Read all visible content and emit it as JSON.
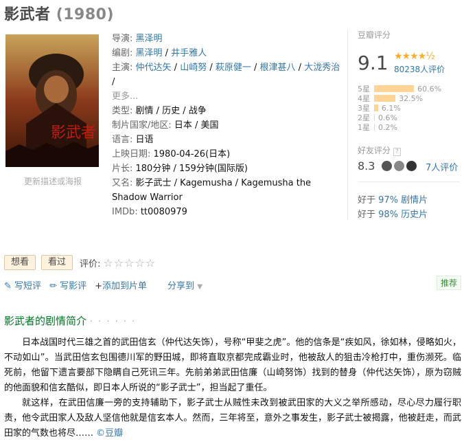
{
  "title": {
    "name": "影武者",
    "year": "(1980)"
  },
  "poster": {
    "update_text": "更新描述或海报",
    "art_text": "影武者"
  },
  "info": {
    "director_label": "导演: ",
    "director": "黑泽明",
    "writer_label": "编剧: ",
    "writers": [
      "黑泽明",
      "井手雅人"
    ],
    "cast_label": "主演: ",
    "cast": [
      "仲代达矢",
      "山崎努",
      "萩原健一",
      "根津甚八",
      "大泷秀治"
    ],
    "more": "更多...",
    "genre_label": "类型: ",
    "genres": "剧情 / 历史 / 战争",
    "country_label": "制片国家/地区: ",
    "country": "日本 / 美国",
    "language_label": "语言: ",
    "language": "日语",
    "release_label": "上映日期: ",
    "release": "1980-04-26(日本)",
    "runtime_label": "片长: ",
    "runtime": "180分钟 / 159分钟(国际版)",
    "aka_label": "又名: ",
    "aka": "影子武士 / Kagemusha / Kagemusha the Shadow Warrior",
    "imdb_label": "IMDb: ",
    "imdb": "tt0080979"
  },
  "rating": {
    "label": "豆瓣评分",
    "score": "9.1",
    "stars": "★★★★½",
    "count": "80238人评价",
    "breakdown": [
      {
        "label": "5星",
        "pct": "60.6%",
        "value": 60.6
      },
      {
        "label": "4星",
        "pct": "32.5%",
        "value": 32.5
      },
      {
        "label": "3星",
        "pct": "6.1%",
        "value": 6.1
      },
      {
        "label": "2星",
        "pct": "0.6%",
        "value": 0.6
      },
      {
        "label": "1星",
        "pct": "0.2%",
        "value": 0.2
      }
    ],
    "friend_label": "好友评分",
    "friend_help": "?",
    "friend_score": "8.3",
    "friend_count": "7人评价",
    "better": [
      {
        "prefix": "好于 ",
        "pct": "97%",
        "genre": " 剧情片"
      },
      {
        "prefix": "好于 ",
        "pct": "98%",
        "genre": " 历史片"
      }
    ]
  },
  "actions": {
    "want": "想看",
    "watched": "看过",
    "rate_label": "评价:",
    "empty_stars": "☆☆☆☆☆",
    "short_review": "写短评",
    "review": "写影评",
    "add_list": "添加到片单",
    "share": "分享到",
    "recommend": "推荐"
  },
  "summary": {
    "title": "影武者的剧情简介",
    "dots": "· · · · · ·",
    "p1": "日本战国时代三雄之首的武田信玄（仲代达矢饰），号称“甲斐之虎”。他的信条是“疾如风，徐如林，侵略如火，不动如山”。当武田信玄包围德川军的野田城，即将直取京都完成霸业时，他被敌人的狙击冷枪打中，重伤濒死。临死前，他留下遗言要部下隐瞒自己死讯三年。先前弟弟武田信廉（山崎努饰）找到的替身（仲代达矢饰），原为窃贼的他面貌和信玄酷似，即日本人所说的“影子武士”，担当起了重任。",
    "p2": "就这样，在武田信廉一旁的支持辅助下，影子武士从贼性未改到被武田家的大义之举所感动，尽心尽力履行职责，他令武田家人及敌人坚信他就是信玄本人。然而，三年将至，意外之事发生，影子武士被揭露，他被赶走，而武田家的气数也将尽……",
    "source": "©豆瓣"
  },
  "colors": {
    "link": "#3377aa",
    "bar": "#ffd596",
    "star": "#ffac2d",
    "section": "#007722"
  }
}
